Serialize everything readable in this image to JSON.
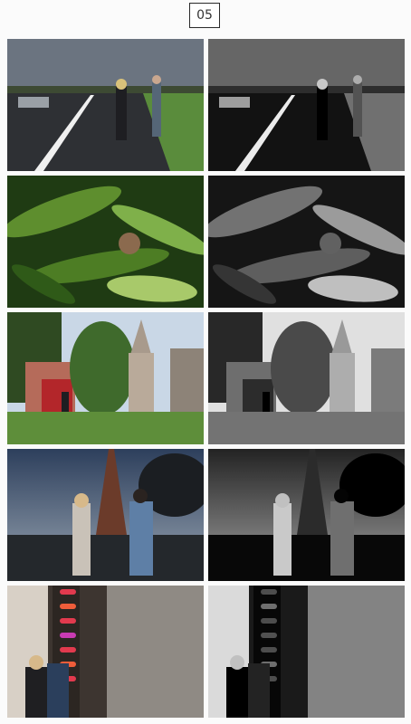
{
  "page": {
    "number": "05"
  },
  "photos": [
    {
      "row": 1,
      "left": "road-couple-color",
      "right": "road-couple-bw",
      "palette": [
        "#5f6a74",
        "#2f3237",
        "#4c7a3a"
      ]
    },
    {
      "row": 2,
      "left": "corn-leaves-color",
      "right": "corn-leaves-bw",
      "palette": [
        "#1f3b13",
        "#5e8e2e",
        "#a8c96a"
      ]
    },
    {
      "row": 3,
      "left": "chateau-garden-color",
      "right": "chateau-garden-bw",
      "palette": [
        "#c9d7e6",
        "#3f6a2c",
        "#b56b5a"
      ]
    },
    {
      "row": 4,
      "left": "eiffel-dusk-color",
      "right": "eiffel-dusk-bw",
      "palette": [
        "#2d3f5c",
        "#9aa6b3",
        "#1b1e22"
      ]
    },
    {
      "row": 5,
      "left": "neon-lights-color",
      "right": "neon-lights-bw",
      "palette": [
        "#3d3530",
        "#e23a4e",
        "#d8d0c6"
      ]
    }
  ]
}
